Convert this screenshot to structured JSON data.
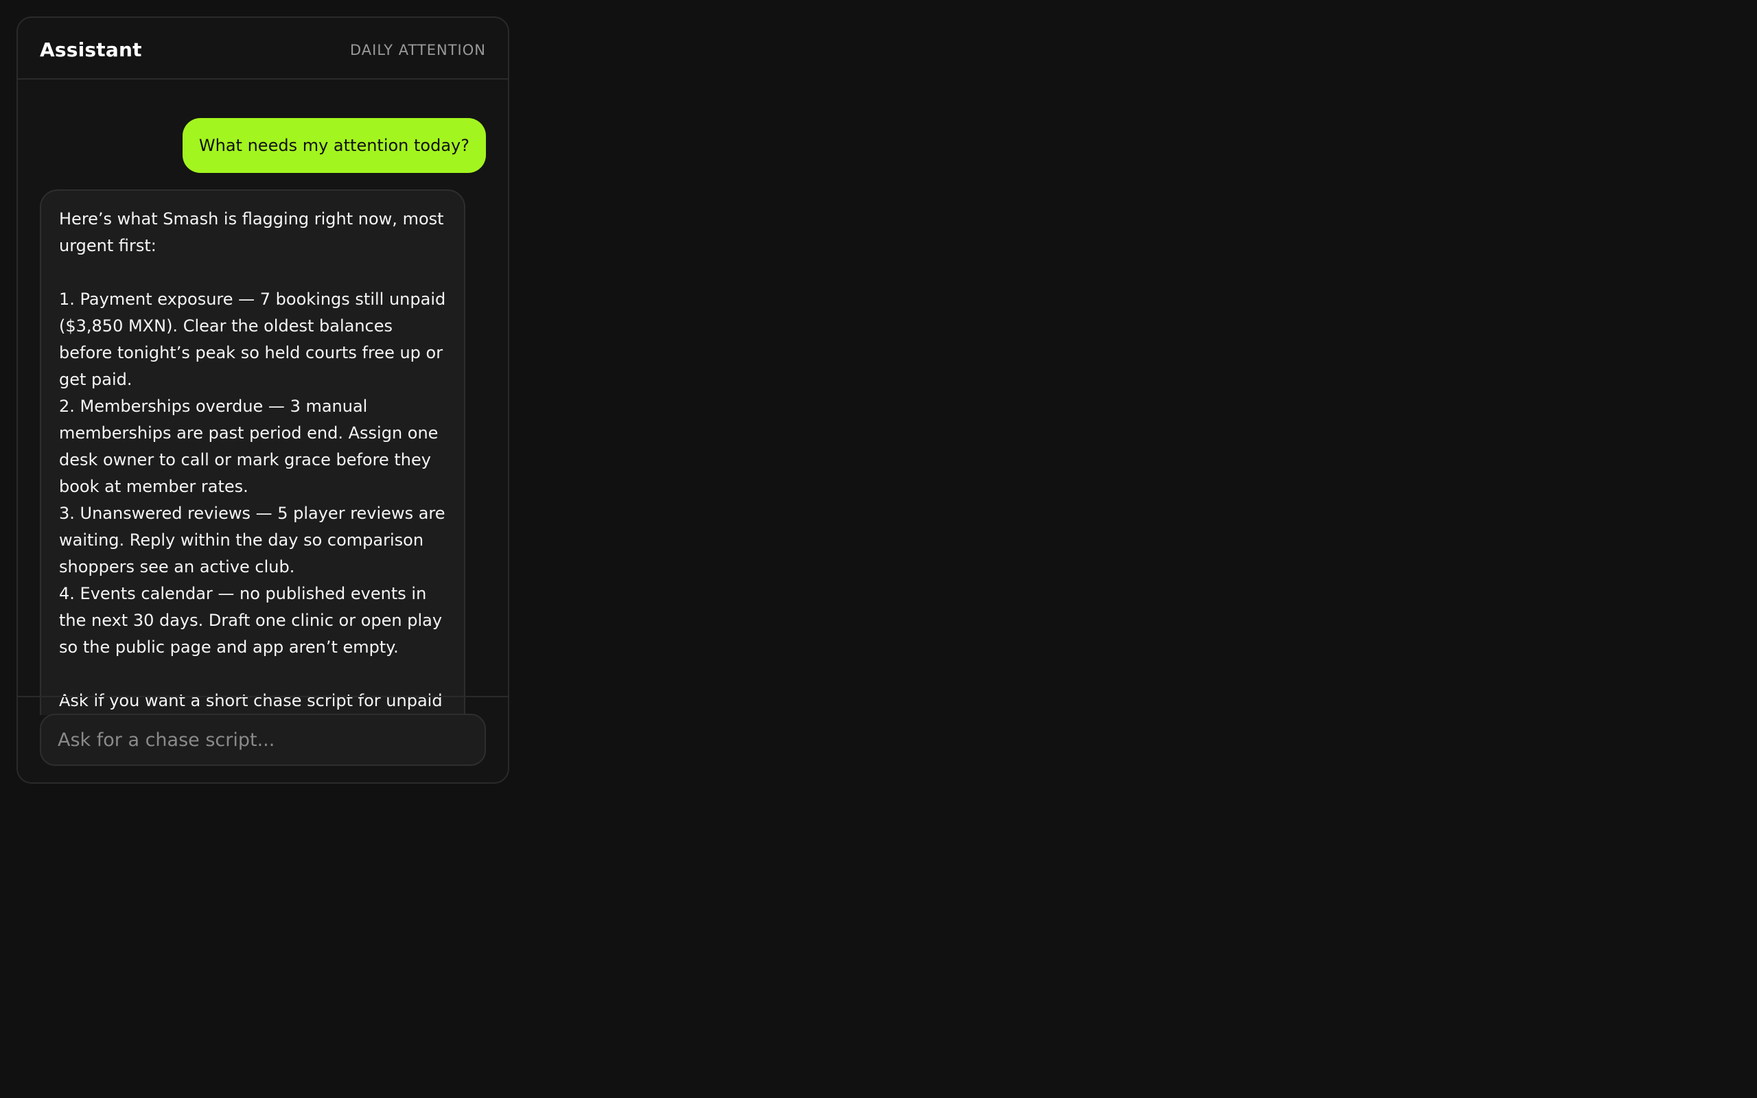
{
  "header": {
    "title": "Assistant",
    "subtitle": "DAILY ATTENTION"
  },
  "messages": {
    "user": "What needs my attention today?",
    "assistant": {
      "intro": "Here’s what Smash is flagging right now, most urgent first:",
      "items": [
        "1. Payment exposure — 7 bookings still unpaid ($3,850 MXN). Clear the oldest balances before tonight’s peak so held courts free up or get paid.",
        "2. Memberships overdue — 3 manual memberships are past period end. Assign one desk owner to call or mark grace before they book at member rates.",
        "3. Unanswered reviews — 5 player reviews are waiting. Reply within the day so comparison shoppers see an active club.",
        "4. Events calendar — no published events in the next 30 days. Draft one clinic or open play so the public page and app aren’t empty."
      ],
      "outro": "Ask if you want a short chase script for unpaid bookings, or ideas for a midweek event."
    }
  },
  "composer": {
    "placeholder": "Ask for a chase script..."
  },
  "colors": {
    "accent": "#a3f51f",
    "background": "#111111",
    "panel": "#141414",
    "bubble": "#1d1d1d"
  }
}
